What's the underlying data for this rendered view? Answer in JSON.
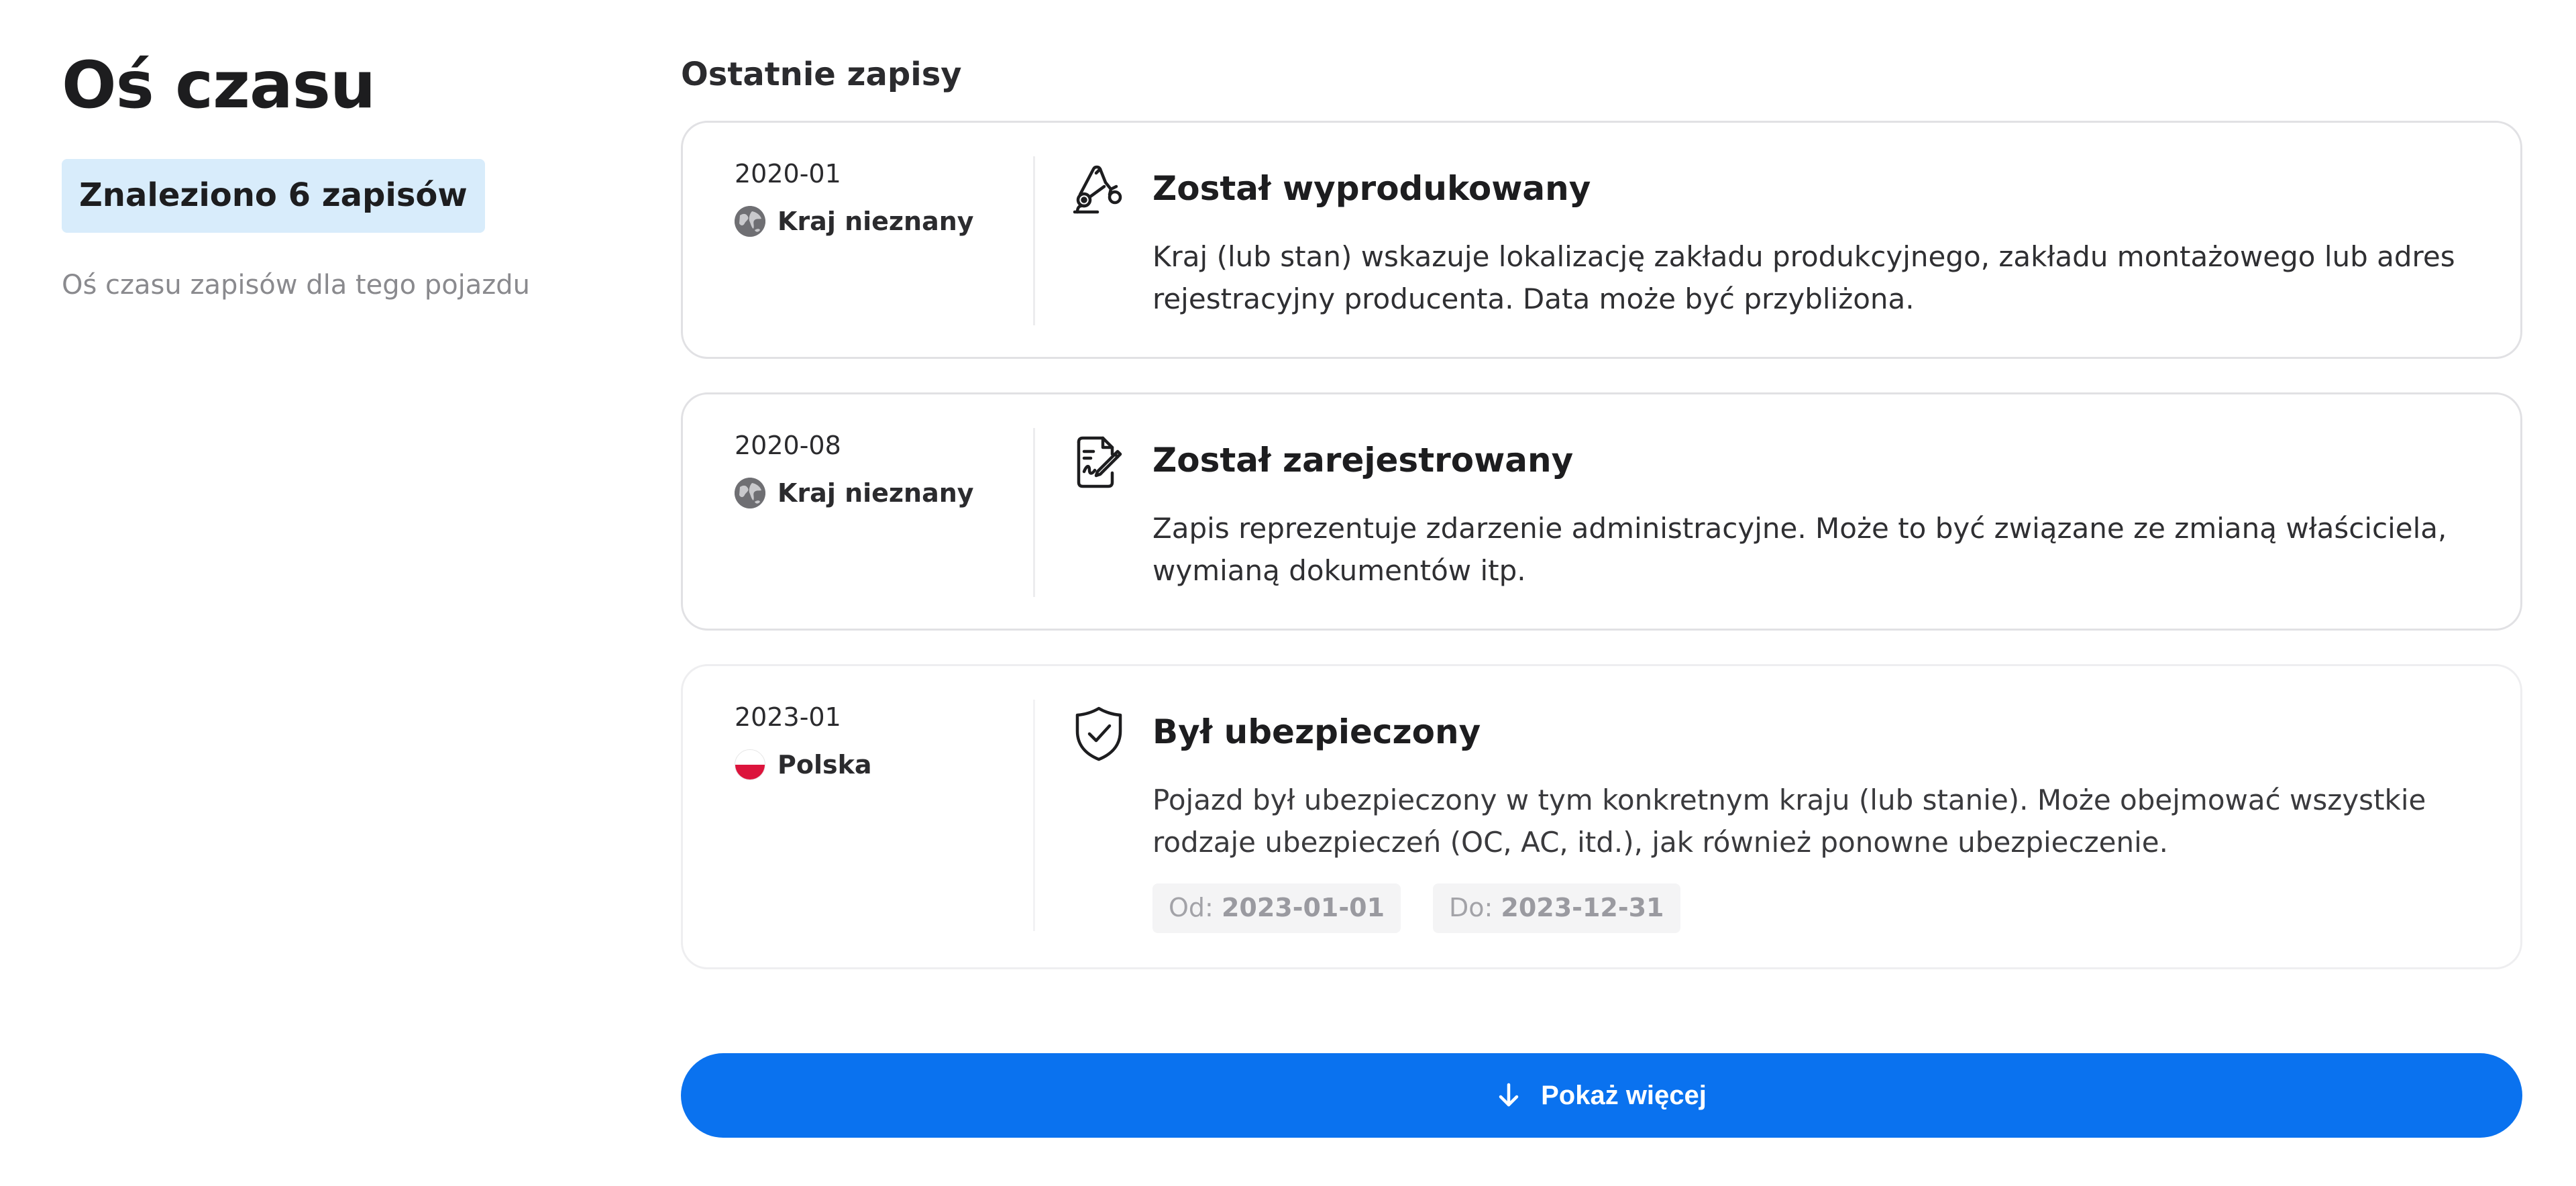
{
  "sidebar": {
    "title": "Oś czasu",
    "count_badge": "Znaleziono 6 zapisów",
    "subtitle": "Oś czasu zapisów dla tego pojazdu"
  },
  "main": {
    "section_title": "Ostatnie zapisy",
    "records": [
      {
        "date": "2020-01",
        "country": "Kraj nieznany",
        "country_icon": "globe-icon",
        "icon": "robot-arm-icon",
        "title": "Został wyprodukowany",
        "description": "Kraj (lub stan) wskazuje lokalizację zakładu produkcyjnego, zakładu montażowego lub adres rejestracyjny producenta. Data może być przybliżona."
      },
      {
        "date": "2020-08",
        "country": "Kraj nieznany",
        "country_icon": "globe-icon",
        "icon": "signed-document-icon",
        "title": "Został zarejestrowany",
        "description": "Zapis reprezentuje zdarzenie administracyjne. Może to być związane ze zmianą właściciela, wymianą dokumentów itp."
      },
      {
        "date": "2023-01",
        "country": "Polska",
        "country_icon": "poland-flag-icon",
        "icon": "shield-check-icon",
        "title": "Był ubezpieczony",
        "description": "Pojazd był ubezpieczony w tym konkretnym kraju (lub stanie). Może obejmować wszystkie rodzaje ubezpieczeń (OC, AC, itd.), jak również ponowne ubezpieczenie.",
        "from_label": "Od:",
        "from_value": "2023-01-01",
        "to_label": "Do:",
        "to_value": "2023-12-31"
      }
    ],
    "show_more_label": "Pokaż więcej"
  },
  "colors": {
    "accent": "#0a72ef",
    "badge_bg": "#d8ecfb",
    "border": "#e1e1e4",
    "poland_red": "#dc143c"
  }
}
